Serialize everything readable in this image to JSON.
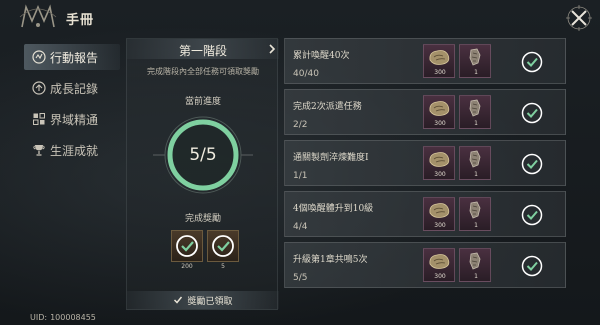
{
  "header": {
    "title": "手冊",
    "logo_icon": "ornate-emblem-icon",
    "close_icon": "close-icon"
  },
  "sidebar": {
    "items": [
      {
        "label": "行動報告",
        "icon": "report-icon",
        "active": true
      },
      {
        "label": "成長記錄",
        "icon": "growth-icon",
        "active": false
      },
      {
        "label": "界域精通",
        "icon": "mastery-icon",
        "active": false
      },
      {
        "label": "生涯成就",
        "icon": "trophy-icon",
        "active": false
      }
    ]
  },
  "uid": {
    "label": "UID:",
    "value": "100008455"
  },
  "stage": {
    "title": "第一階段",
    "description": "完成階段內全部任務可領取獎勵",
    "progress_label": "當前進度",
    "progress_text": "5/5",
    "progress_fraction": 1.0,
    "reward_label": "完成獎勵",
    "rewards": [
      {
        "qty": "200",
        "icon": "claimed-check-icon"
      },
      {
        "qty": "5",
        "icon": "claimed-check-icon"
      }
    ],
    "claimed_label": "獎勵已領取"
  },
  "tasks": [
    {
      "title": "累計喚醒40次",
      "progress": "40/40",
      "reward1_qty": "300",
      "reward2_qty": "1"
    },
    {
      "title": "完成2次派遣任務",
      "progress": "2/2",
      "reward1_qty": "300",
      "reward2_qty": "1"
    },
    {
      "title": "通關製劑淬煉難度Ⅰ",
      "progress": "1/1",
      "reward1_qty": "300",
      "reward2_qty": "1"
    },
    {
      "title": "4個喚醒體升到10級",
      "progress": "4/4",
      "reward1_qty": "300",
      "reward2_qty": "1"
    },
    {
      "title": "升級第1章共鳴5次",
      "progress": "5/5",
      "reward1_qty": "300",
      "reward2_qty": "1"
    }
  ],
  "colors": {
    "accent_green": "#7fd0a0",
    "background": "#15191d",
    "reward_purple": "#4a3040",
    "reward_brown": "#4a3a2a"
  }
}
